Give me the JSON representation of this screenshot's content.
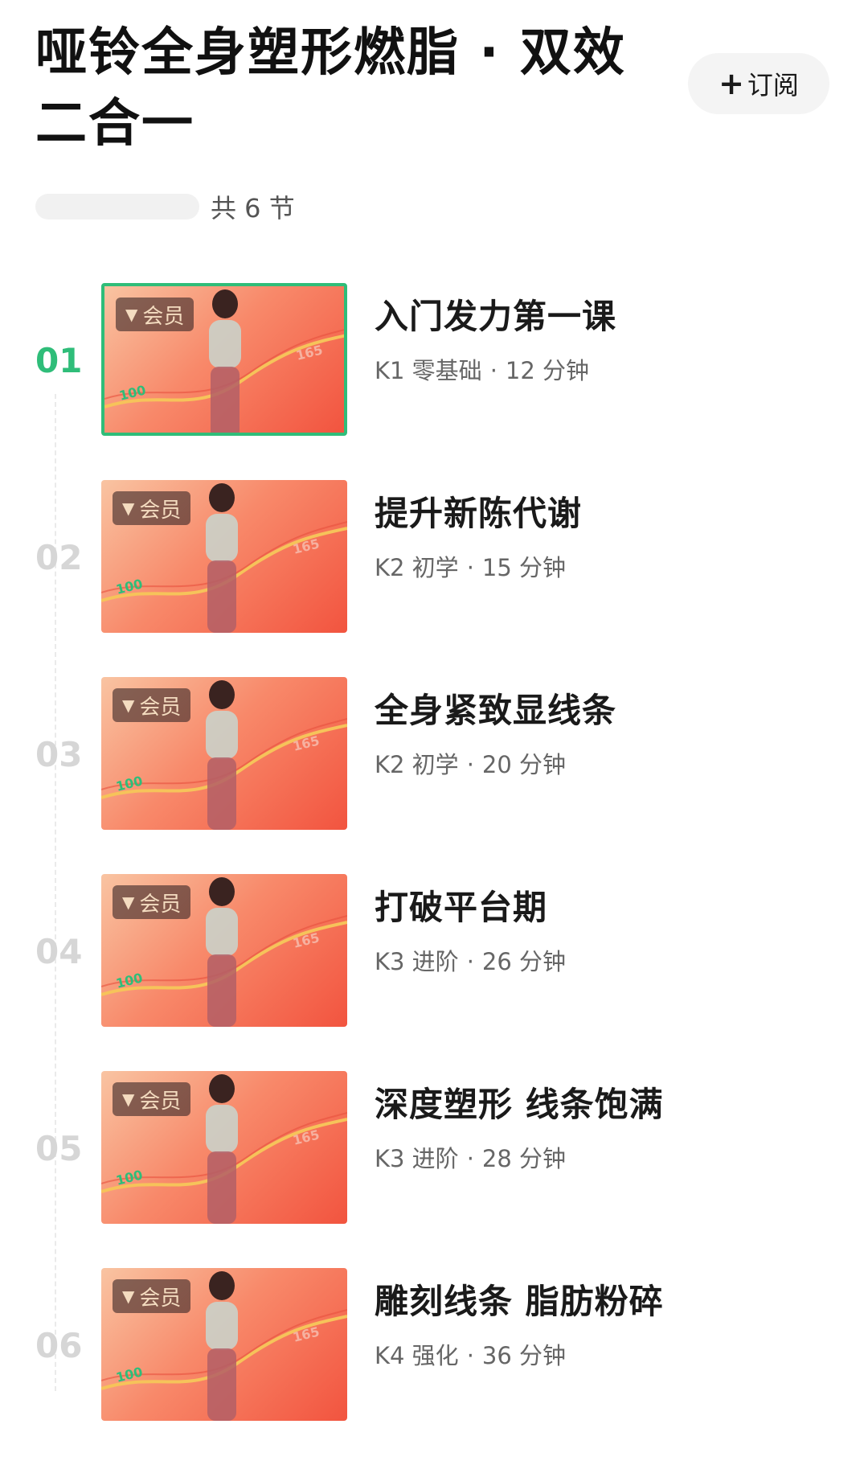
{
  "header": {
    "title": "哑铃全身塑形燃脂 · 双效二合一",
    "subscribe_label": "订阅",
    "subscribe_icon": "plus-icon"
  },
  "meta": {
    "count_text": "共 6 节"
  },
  "badge_label": "会员",
  "thumbnail_marks": {
    "start": "100",
    "end": "165"
  },
  "colors": {
    "accent": "#2fbd79",
    "thumb_top": "#f9c4a2",
    "thumb_bottom": "#f2543f"
  },
  "lessons": [
    {
      "num": "01",
      "title": "入门发力第一课",
      "level": "K1 零基础",
      "duration": "12 分钟",
      "active": true
    },
    {
      "num": "02",
      "title": "提升新陈代谢",
      "level": "K2 初学",
      "duration": "15 分钟",
      "active": false
    },
    {
      "num": "03",
      "title": "全身紧致显线条",
      "level": "K2 初学",
      "duration": "20 分钟",
      "active": false
    },
    {
      "num": "04",
      "title": "打破平台期",
      "level": "K3 进阶",
      "duration": "26 分钟",
      "active": false
    },
    {
      "num": "05",
      "title": "深度塑形 线条饱满",
      "level": "K3 进阶",
      "duration": "28 分钟",
      "active": false
    },
    {
      "num": "06",
      "title": "雕刻线条 脂肪粉碎",
      "level": "K4 强化",
      "duration": "36 分钟",
      "active": false
    }
  ]
}
